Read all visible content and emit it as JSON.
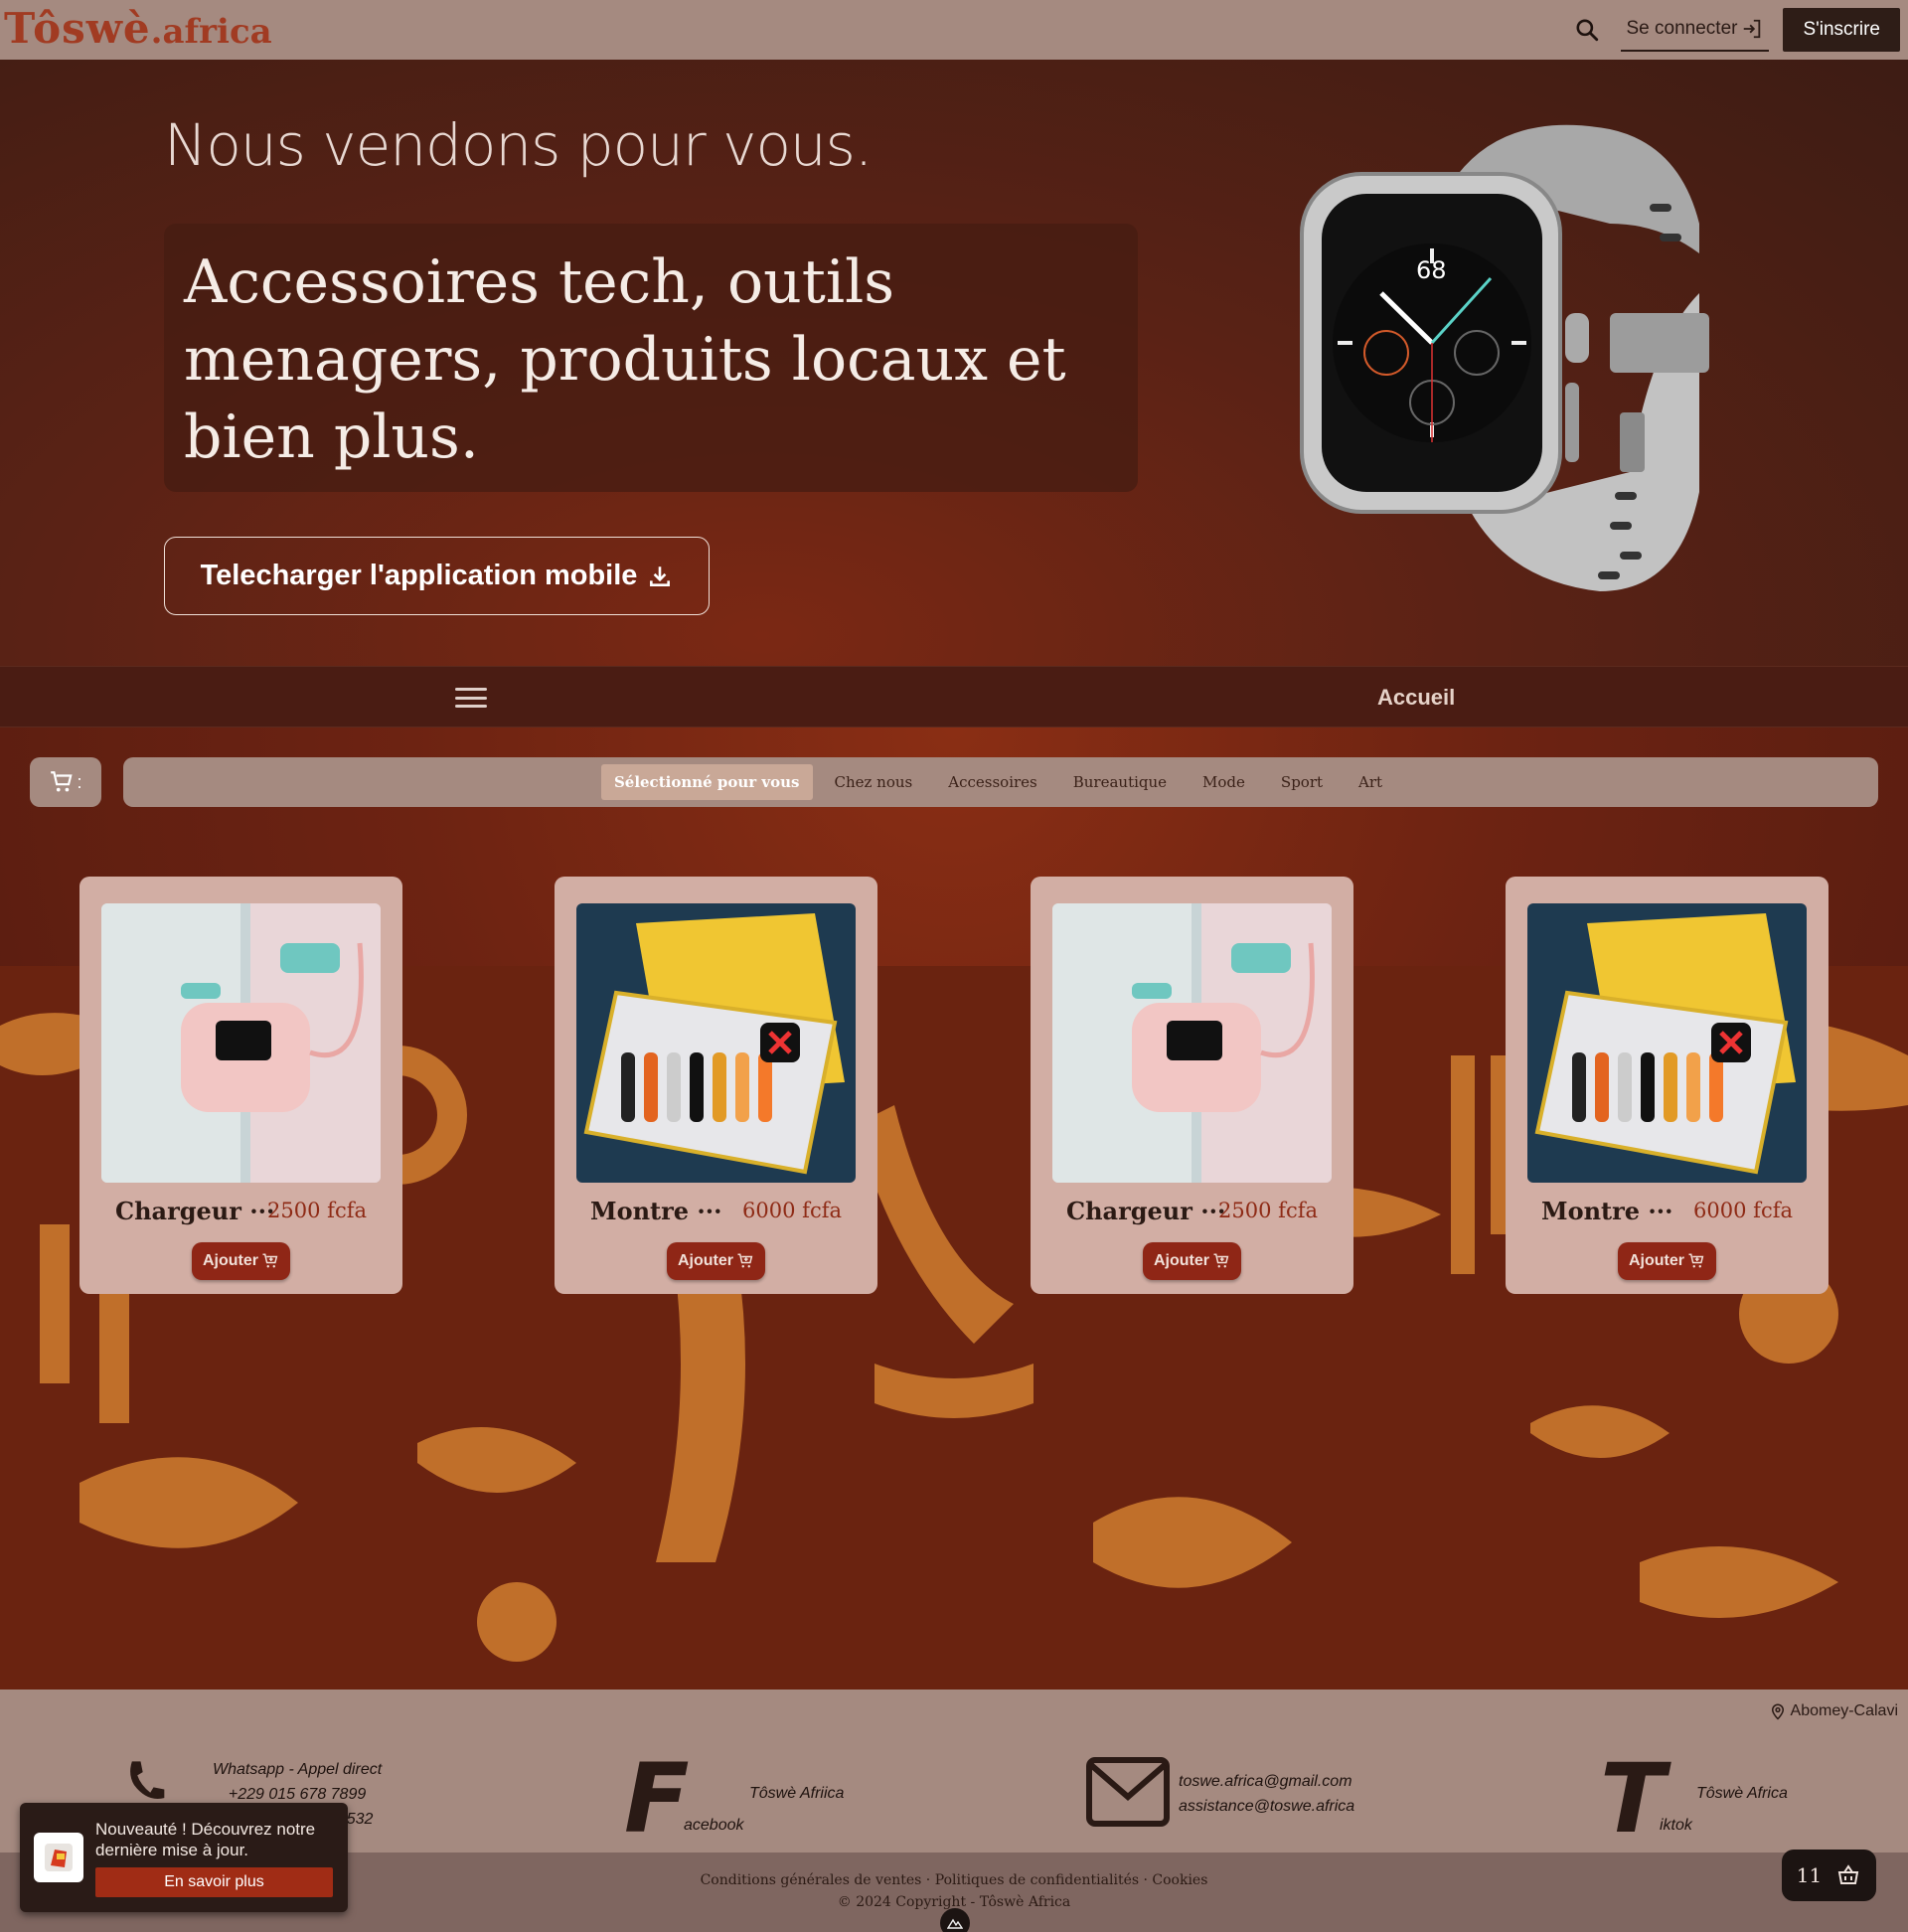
{
  "header": {
    "logo_brand": "Tôswè",
    "logo_tld": ".africa",
    "login_label": "Se connecter",
    "signup_label": "S'inscrire",
    "icons": [
      "search-icon",
      "login-icon"
    ]
  },
  "hero": {
    "tagline": "Nous vendons pour vous.",
    "headline": "Accessoires tech, outils menagers, produits locaux et bien plus.",
    "download_label": "Telecharger l'application mobile"
  },
  "secondary_nav": {
    "home_label": "Accueil"
  },
  "cart_chip": {
    "suffix": ":"
  },
  "tabs": [
    {
      "label": "Sélectionné pour vous",
      "active": true
    },
    {
      "label": "Chez nous",
      "active": false
    },
    {
      "label": "Accessoires",
      "active": false
    },
    {
      "label": "Bureautique",
      "active": false
    },
    {
      "label": "Mode",
      "active": false
    },
    {
      "label": "Sport",
      "active": false
    },
    {
      "label": "Art",
      "active": false
    }
  ],
  "products": [
    {
      "title": "Chargeur ···",
      "price": "2500 fcfa",
      "add_label": "Ajouter",
      "image": "pink-powerbank"
    },
    {
      "title": "Montre ···",
      "price": "6000 fcfa",
      "add_label": "Ajouter",
      "image": "watch-strap-box"
    },
    {
      "title": "Chargeur ···",
      "price": "2500 fcfa",
      "add_label": "Ajouter",
      "image": "pink-powerbank"
    },
    {
      "title": "Montre ···",
      "price": "6000 fcfa",
      "add_label": "Ajouter",
      "image": "watch-strap-box"
    }
  ],
  "footer": {
    "location": "Abomey-Calavi",
    "whatsapp": {
      "title": "Whatsapp - Appel direct",
      "phone1": "+229 015 678 7899",
      "phone2": "···532"
    },
    "facebook": {
      "letter": "F",
      "rest": "acebook",
      "name": "Tôswè Afriica"
    },
    "email": {
      "line1": "toswe.africa@gmail.com",
      "line2": "assistance@toswe.africa"
    },
    "tiktok": {
      "letter": "T",
      "rest": "iktok",
      "name": "Tôswè Africa"
    },
    "legal_links": [
      "Conditions générales de ventes",
      "Politiques de confidentialités",
      "Cookies"
    ],
    "copyright": "© 2024 Copyright - Tôswè Africa"
  },
  "toast": {
    "message": "Nouveauté ! Découvrez notre dernière mise à jour.",
    "button": "En savoir plus"
  },
  "floating_cart": {
    "count": "11"
  },
  "colors": {
    "accent": "#8f2616",
    "nav_bg": "#a58a80",
    "card_bg": "#d2aea4",
    "dark": "#2e1d17"
  }
}
